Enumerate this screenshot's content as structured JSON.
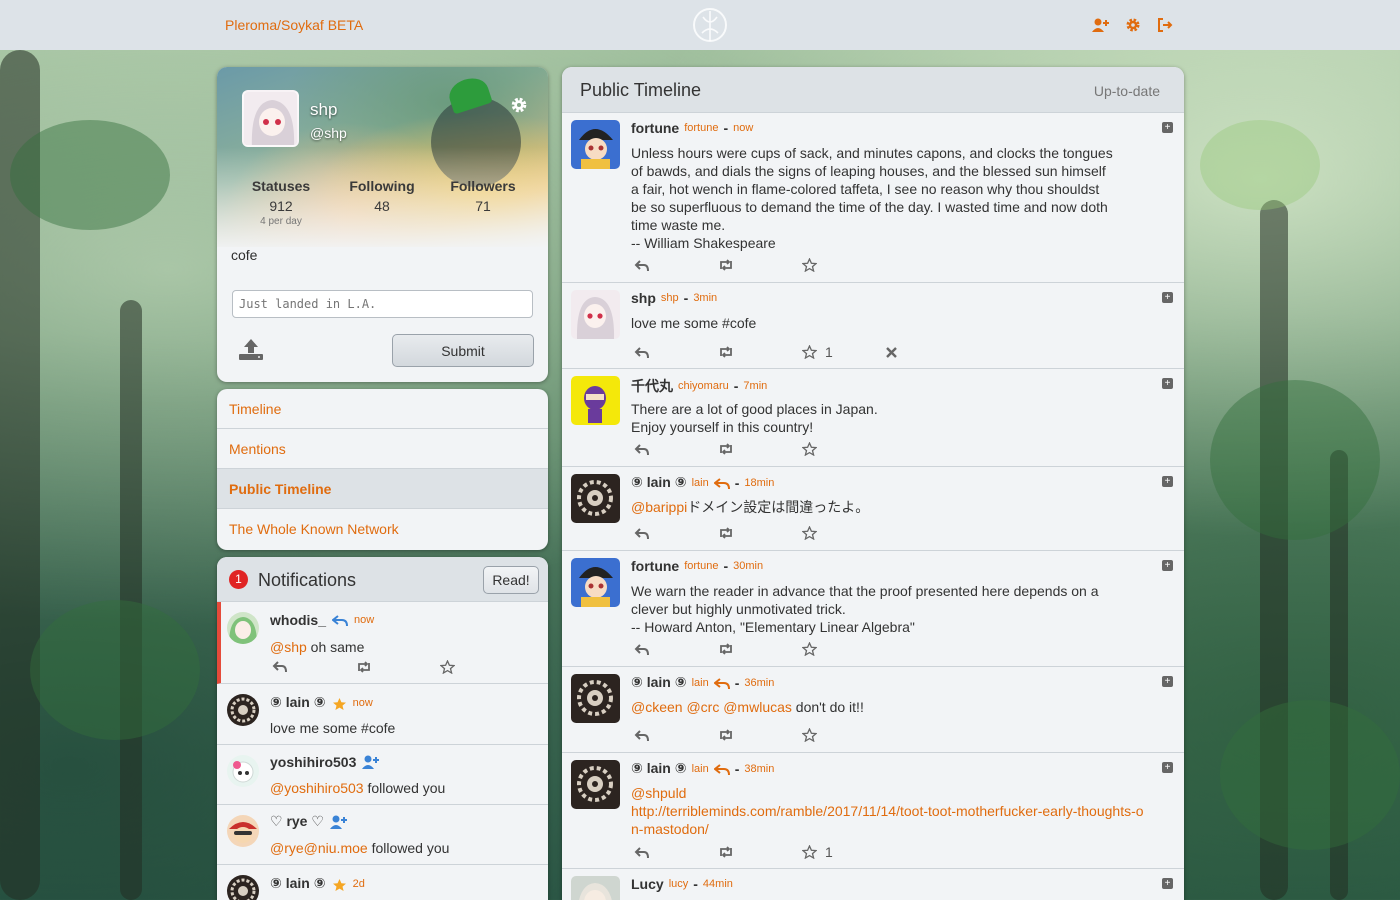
{
  "colors": {
    "accent": "#e06c0f",
    "panel": "#f2f4f6",
    "topbar": "#dde3e8",
    "badge": "#e02424"
  },
  "topbar": {
    "brand": "Pleroma/Soykaf BETA",
    "icons": [
      "user-plus-icon",
      "gear-icon",
      "logout-icon"
    ]
  },
  "user_card": {
    "name": "shp",
    "handle": "@shp",
    "stats": {
      "statuses_label": "Statuses",
      "statuses": "912",
      "per_day": "4 per day",
      "following_label": "Following",
      "following": "48",
      "followers_label": "Followers",
      "followers": "71"
    },
    "bio": "cofe",
    "post_placeholder": "Just landed in L.A.",
    "submit_label": "Submit"
  },
  "nav": {
    "items": [
      {
        "label": "Timeline"
      },
      {
        "label": "Mentions"
      },
      {
        "label": "Public Timeline",
        "active": true
      },
      {
        "label": "The Whole Known Network"
      }
    ]
  },
  "notifications": {
    "count": "1",
    "title": "Notifications",
    "read_label": "Read!",
    "items": [
      {
        "name": "whodis_",
        "icon": "reply-icon",
        "time": "now",
        "mention": "@shp",
        "text": " oh same"
      },
      {
        "name": "⑨ lain ⑨",
        "icon": "star-icon",
        "time": "now",
        "text": "love me some #cofe"
      },
      {
        "name": "yoshihiro503",
        "icon": "user-plus-icon",
        "handle": "@yoshihiro503",
        "text": " followed you"
      },
      {
        "name": "♡ rye ♡",
        "icon": "user-plus-icon",
        "handle": "@rye@niu.moe",
        "text": " followed you"
      },
      {
        "name": "⑨ lain ⑨",
        "icon": "star-icon",
        "time": "2d"
      }
    ]
  },
  "timeline": {
    "title": "Public Timeline",
    "status": "Up-to-date",
    "statuses": [
      {
        "name": "fortune",
        "user": "fortune",
        "time": "now",
        "lines": [
          "Unless hours were cups of sack, and minutes capons, and clocks the tongues",
          "of bawds, and dials the signs of leaping houses, and the blessed sun himself",
          "a fair, hot wench in flame-colored taffeta, I see no reason why thou shouldst",
          "be so superfluous to demand the time of the day. I wasted time and now doth",
          "time waste me.",
          "-- William Shakespeare"
        ]
      },
      {
        "name": "shp",
        "user": "shp",
        "time": "3min",
        "lines": [
          "love me some #cofe"
        ],
        "fav_count": "1"
      },
      {
        "name": "千代丸",
        "user": "chiyomaru",
        "time": "7min",
        "lines": [
          "There are a lot of good places in Japan.",
          "Enjoy yourself in this country!"
        ]
      },
      {
        "name": "⑨ lain ⑨",
        "user": "lain",
        "time": "18min",
        "mention": "@barippi",
        "text": "ドメイン設定は間違ったよ。"
      },
      {
        "name": "fortune",
        "user": "fortune",
        "time": "30min",
        "lines": [
          "We warn the reader in advance that the proof presented here depends on a",
          "clever but highly unmotivated trick.",
          "-- Howard Anton, \"Elementary Linear Algebra\""
        ]
      },
      {
        "name": "⑨ lain ⑨",
        "user": "lain",
        "time": "36min",
        "mentions": "@ckeen @crc @mwlucas",
        "text": " don't do it!!"
      },
      {
        "name": "⑨ lain ⑨",
        "user": "lain",
        "time": "38min",
        "mention": "@shpuld",
        "link": "http://terribleminds.com/ramble/2017/11/14/toot-toot-motherfucker-early-thoughts-o",
        "link2": "n-mastodon/",
        "fav_count": "1"
      },
      {
        "name": "Lucy",
        "user": "lucy",
        "time": "44min"
      }
    ]
  }
}
